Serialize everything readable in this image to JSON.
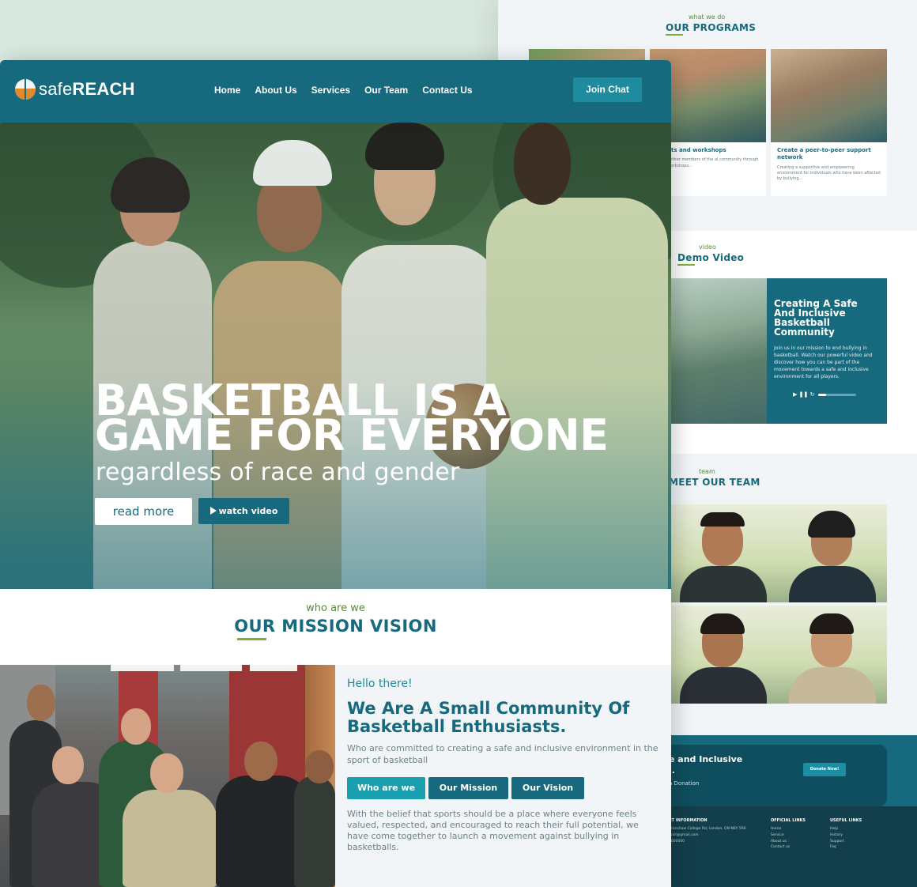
{
  "background_page": {
    "programs": {
      "eyebrow": "what we do",
      "title": "OUR PROGRAMS",
      "cards": [
        {
          "title": "",
          "desc": ""
        },
        {
          "title": "events and workshops",
          "desc": "ing together members of the al community through events orkshops..."
        },
        {
          "title": "Create a peer-to-peer support network",
          "desc": "Creating a supportive and empowering environment for individuals who have been affected by bullying..."
        }
      ]
    },
    "video": {
      "eyebrow": "video",
      "title": "Demo Video",
      "panel_title": "Creating A Safe And Inclusive Basketball Community",
      "panel_desc": "Join us in our mission to end bullying in basketball. Watch our powerful video and discover how you can be part of the movement towards a safe and inclusive environment for all players.",
      "controls": "▶ ❚❚ ↻"
    },
    "team": {
      "eyebrow": "team",
      "title": "MEET OUR TEAM"
    },
    "donate": {
      "title_line1": "e and Inclusive",
      "title_line2": "l.",
      "sub": "a Donation",
      "button": "Donate Now!"
    },
    "footer": {
      "col1": {
        "heading": "CT INFORMATION",
        "lines": [
          "Branshaw College Rd, London, ON N6Y 5R6",
          "mail@gmail.com",
          "0000000"
        ]
      },
      "col2": {
        "heading": "OFFICIAL LINKS",
        "lines": [
          "Home",
          "Service",
          "About us",
          "Contact us"
        ]
      },
      "col3": {
        "heading": "USEFUL LINKS",
        "lines": [
          "Help",
          "History",
          "Support",
          "Faq"
        ]
      }
    }
  },
  "header": {
    "logo_light": "safe",
    "logo_bold": "REACH",
    "nav": [
      "Home",
      "About Us",
      "Services",
      "Our Team",
      "Contact Us"
    ],
    "join_label": "Join Chat"
  },
  "hero": {
    "title_line1": "BASKETBALL IS A",
    "title_line2": "GAME FOR EVERYONE",
    "subtitle": "regardless of race and gender",
    "read_more": "read more",
    "watch_video": "watch video"
  },
  "mission": {
    "eyebrow": "who are we",
    "title": "OUR MISSION VISION",
    "hello": "Hello there!",
    "heading": "We Are A Small Community Of Basketball Enthusiasts.",
    "desc": "Who are committed to creating a safe and inclusive environment in the sport of basketball",
    "tabs": [
      "Who are we",
      "Our Mission",
      "Our Vision"
    ],
    "body": "With the belief that sports should be a place where everyone feels valued, respected, and encouraged to reach their full potential, we have come together to launch a movement against bullying in basketballs."
  },
  "colors": {
    "primary": "#176a7e",
    "accent": "#1a9fb0",
    "green": "#7cae3f",
    "eyebrow": "#5a8a3c"
  }
}
